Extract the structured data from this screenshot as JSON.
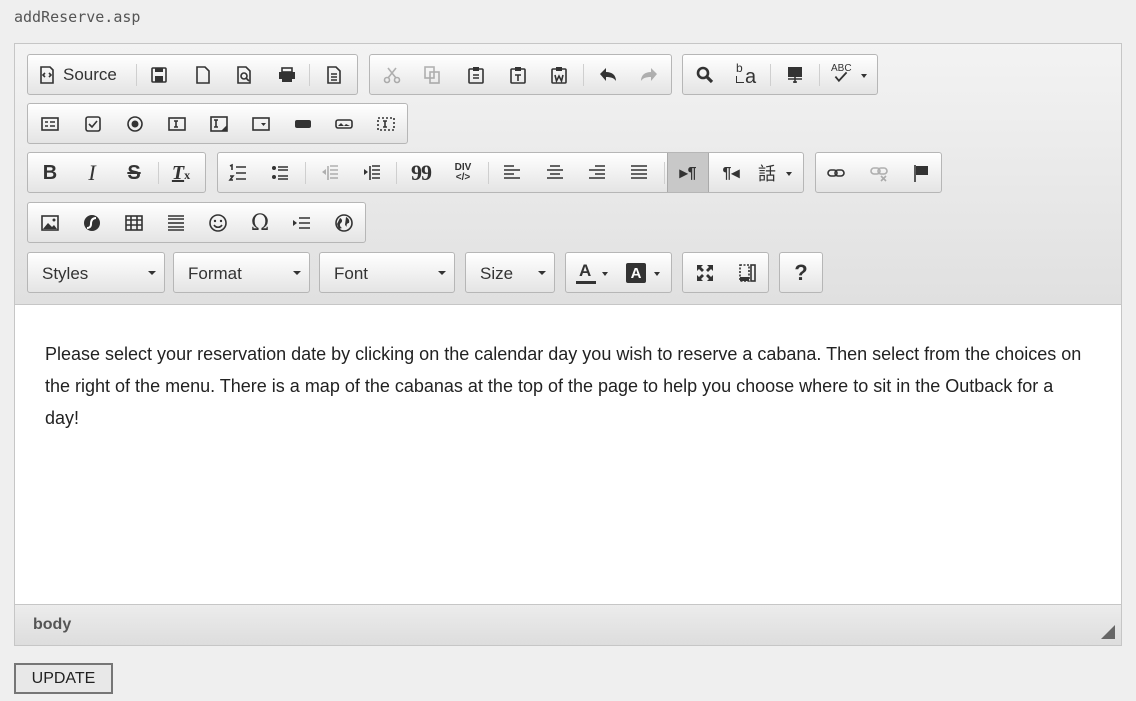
{
  "page": {
    "title": "addReserve.asp"
  },
  "toolbar": {
    "source_label": "Source",
    "styles_label": "Styles",
    "format_label": "Format",
    "font_label": "Font",
    "size_label": "Size",
    "help_label": "?",
    "icons": {
      "source": "source-icon",
      "save": "save-icon",
      "new_page": "new-page-icon",
      "preview": "preview-icon",
      "print": "print-icon",
      "templates": "templates-icon",
      "cut": "cut-icon",
      "copy": "copy-icon",
      "paste": "paste-icon",
      "paste_text": "paste-text-icon",
      "paste_word": "paste-word-icon",
      "undo": "undo-icon",
      "redo": "redo-icon",
      "find": "find-icon",
      "replace": "replace-icon",
      "select_all": "select-all-icon",
      "spellcheck": "spellcheck-icon"
    },
    "spell_glyph": "ABC",
    "replace_glyph_top": "b",
    "replace_glyph_bottom": "a",
    "bold_glyph": "B",
    "italic_glyph": "I",
    "strike_glyph": "S",
    "remove_format_glyph": "T",
    "blockquote_glyph": "99",
    "div_glyph_top": "DIV",
    "div_glyph_bottom": "</>",
    "ltr_glyph": "¶",
    "rtl_glyph": "¶",
    "language_glyph": "話",
    "special_char_glyph": "Ω",
    "text_color_glyph": "A",
    "bg_color_glyph": "A"
  },
  "content": {
    "text": "Please select your reservation date by clicking on the calendar day you wish to reserve a cabana. Then select from the choices on the right of the menu. There is a map of the cabanas at the top of the page to help you choose where to sit in the Outback for a day!"
  },
  "statusbar": {
    "path": "body"
  },
  "actions": {
    "update_label": "UPDATE"
  }
}
